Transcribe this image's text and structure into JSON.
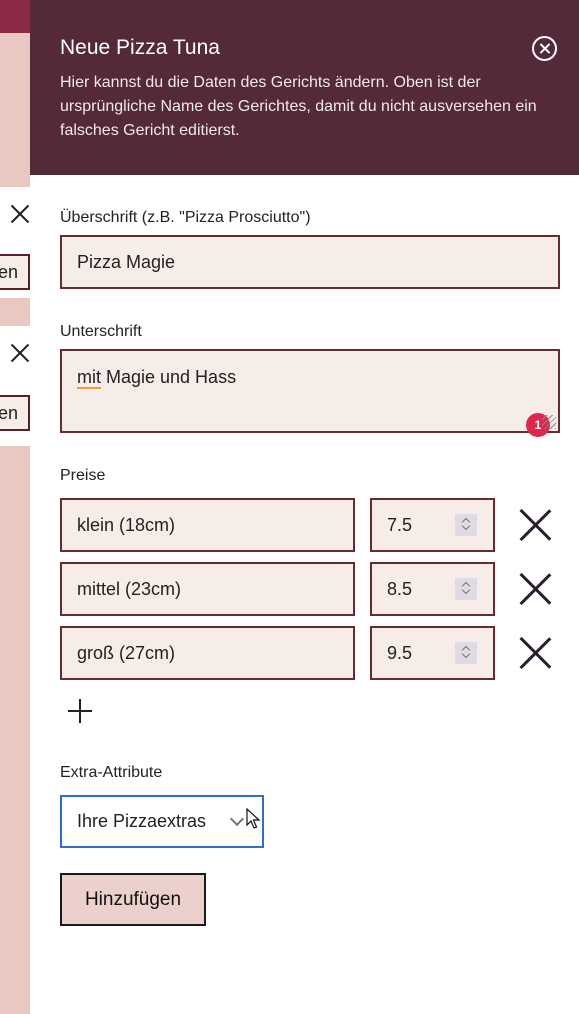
{
  "background": {
    "card1_button_text": "en",
    "card2_button_text": "en"
  },
  "panel": {
    "title": "Neue Pizza Tuna",
    "description": "Hier kannst du die Daten des Gerichts ändern. Oben ist der ursprüngliche Name des Gerichtes, damit du nicht ausversehen ein falsches Gericht editierst."
  },
  "form": {
    "heading_label": "Überschrift (z.B. \"Pizza Prosciutto\")",
    "heading_value": "Pizza Magie",
    "subheading_label": "Unterschrift",
    "subheading_value_underlined": "mit",
    "subheading_value_rest": " Magie und Hass",
    "spelling_badge": "1",
    "prices_label": "Preise",
    "prices": [
      {
        "size": "klein (18cm)",
        "price": "7.5"
      },
      {
        "size": "mittel (23cm)",
        "price": "8.5"
      },
      {
        "size": "groß (27cm)",
        "price": "9.5"
      }
    ],
    "extras_label": "Extra-Attribute",
    "extras_select_value": "Ihre Pizzaextras",
    "add_button": "Hinzufügen"
  }
}
